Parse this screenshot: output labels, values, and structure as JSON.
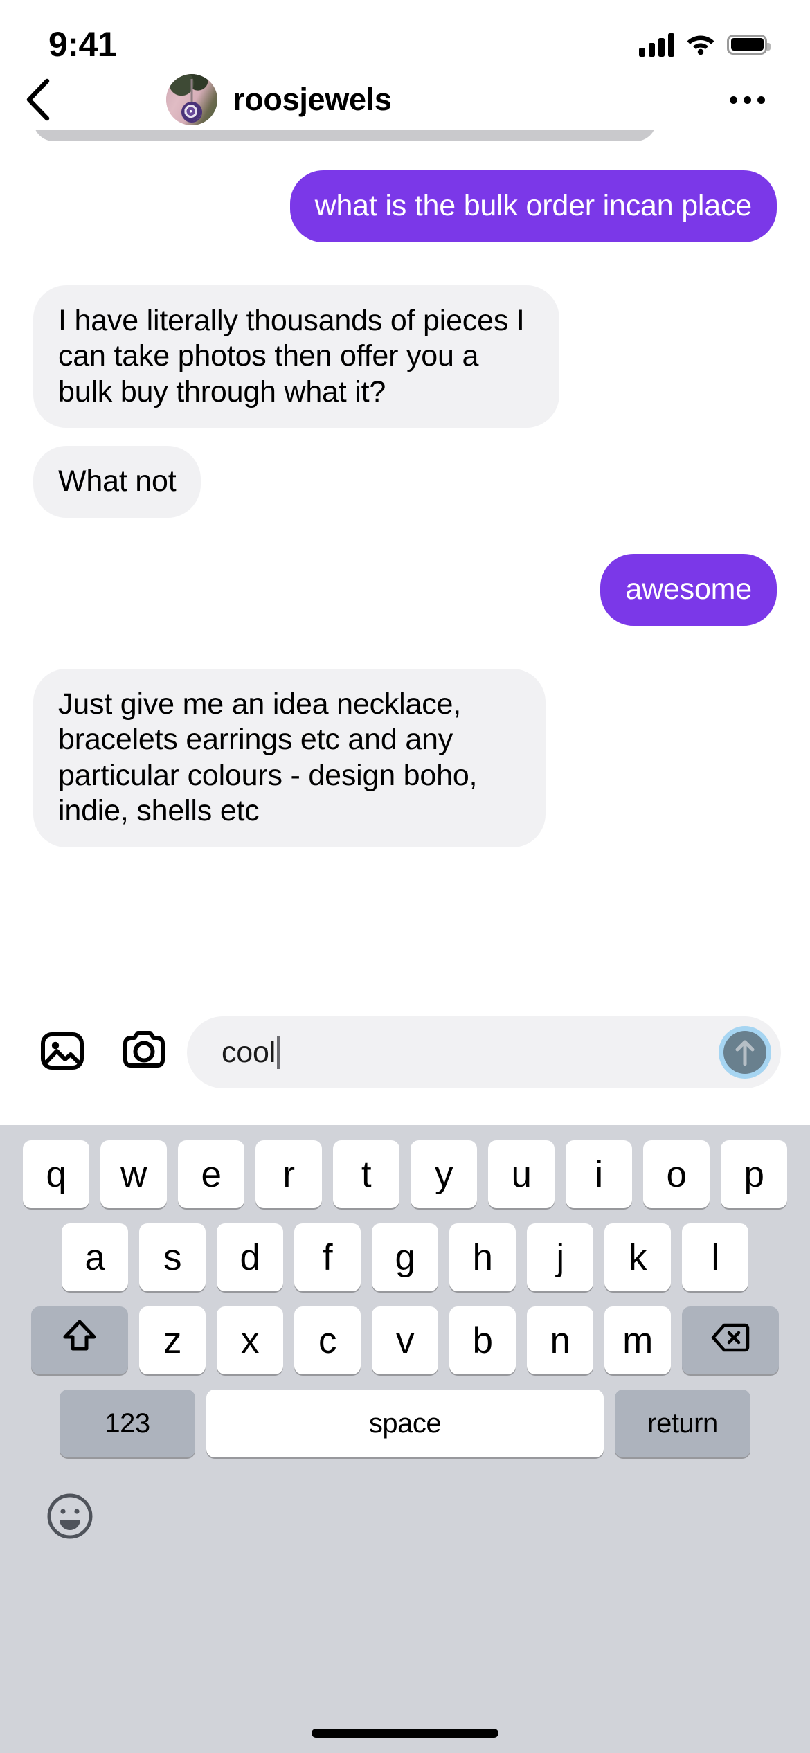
{
  "status_bar": {
    "time": "9:41",
    "cellular_icon": "signal-bars-icon",
    "wifi_icon": "wifi-icon",
    "battery_icon": "battery-full-icon"
  },
  "header": {
    "back_icon": "back-chevron-icon",
    "avatar_label": "roosjewels-avatar",
    "username": "roosjewels",
    "more_icon": "more-options-icon"
  },
  "thread": {
    "messages": [
      {
        "id": "m0",
        "type": "media",
        "direction": "in",
        "label": "necklace-photo-attachment"
      },
      {
        "id": "m1",
        "type": "text",
        "direction": "out",
        "text": "what is the bulk order incan place"
      },
      {
        "id": "m2",
        "type": "text",
        "direction": "in",
        "text": "I have literally thousands of pieces I can take photos then offer you a bulk buy through what it?"
      },
      {
        "id": "m3",
        "type": "text",
        "direction": "in",
        "text": "What not"
      },
      {
        "id": "m4",
        "type": "text",
        "direction": "out",
        "text": "awesome"
      },
      {
        "id": "m5",
        "type": "text",
        "direction": "in",
        "text": "Just give me an idea necklace, bracelets earrings etc and any particular colours - design boho, indie, shells etc"
      }
    ]
  },
  "composer": {
    "gallery_icon": "photo-library-icon",
    "camera_icon": "camera-icon",
    "input_value": "cool",
    "input_placeholder": "Message...",
    "send_icon": "send-arrow-up-icon"
  },
  "keyboard": {
    "row1": [
      "q",
      "w",
      "e",
      "r",
      "t",
      "y",
      "u",
      "i",
      "o",
      "p"
    ],
    "row2": [
      "a",
      "s",
      "d",
      "f",
      "g",
      "h",
      "j",
      "k",
      "l"
    ],
    "row3": [
      "z",
      "x",
      "c",
      "v",
      "b",
      "n",
      "m"
    ],
    "shift_icon": "shift-arrow-icon",
    "backspace_icon": "backspace-delete-icon",
    "numbers_key": "123",
    "space_key": "space",
    "return_key": "return",
    "emoji_icon": "emoji-smiley-icon"
  },
  "colors": {
    "outgoing_bubble": "#7B38E8",
    "incoming_bubble": "#f1f1f3",
    "keyboard_bg": "#d1d3d9",
    "key_mod": "#adb3bd",
    "send_ring": "#a6d5f2",
    "send_core": "#69808e"
  }
}
